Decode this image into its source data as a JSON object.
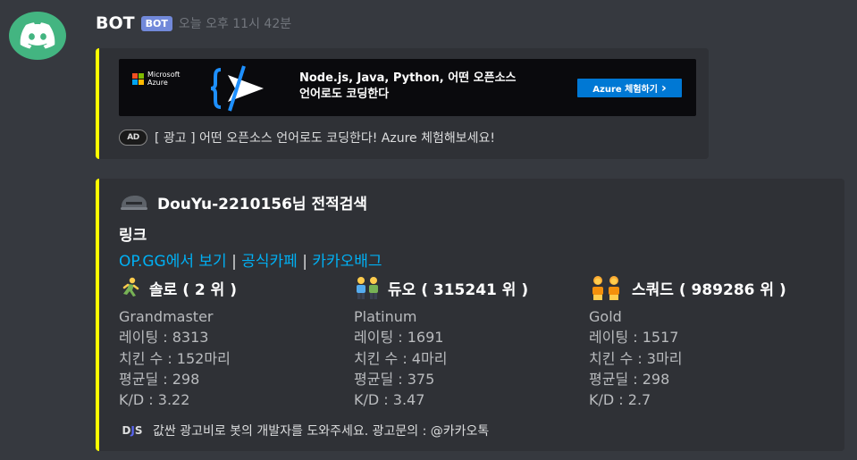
{
  "message": {
    "author": "BOT",
    "bot_tag": "BOT",
    "timestamp": "오늘 오후 11시 42분"
  },
  "ad_embed": {
    "banner": {
      "brand_line1": "Microsoft",
      "brand_line2": "Azure",
      "headline_line1": "Node.js, Java, Python, 어떤 오픈소스",
      "headline_line2": "언어로도 코딩한다",
      "cta_label": "Azure 체험하기",
      "cta_arrow": "›"
    },
    "footer_icon_text": "AD",
    "footer_text": "[ 광고 ] 어떤 오픈소스 언어로도 코딩한다! Azure 체험해보세요!"
  },
  "stats_embed": {
    "author_name": "DouYu-2210156님 전적검색",
    "field_title": "링크",
    "links": [
      "OP.GG에서 보기",
      "공식카페",
      "카카오배그"
    ],
    "link_separator": " | ",
    "columns": [
      {
        "icon": "solo-runner-emoji",
        "title": "솔로 ( 2 위 )",
        "tier": "Grandmaster",
        "rating": "레이팅 : 8313",
        "kills": "치킨 수 : 152마리",
        "avg_damage": "평균딜 : 298",
        "kd": "K/D : 3.22"
      },
      {
        "icon": "duo-people-emoji",
        "title": "듀오 ( 315241 위 )",
        "tier": "Platinum",
        "rating": "레이팅 : 1691",
        "kills": "치킨 수 : 4마리",
        "avg_damage": "평균딜 : 375",
        "kd": "K/D : 3.47"
      },
      {
        "icon": "squad-people-emoji",
        "title": "스쿼드 ( 989286 위 )",
        "tier": "Gold",
        "rating": "레이팅 : 1517",
        "kills": "치킨 수 : 3마리",
        "avg_damage": "평균딜 : 298",
        "kd": "K/D : 2.7"
      }
    ],
    "footer_icon_text_d": "D",
    "footer_icon_text_j": "J",
    "footer_icon_text_s": "S",
    "footer_text": "값싼 광고비로 봇의 개발자를 도와주세요. 광고문의 : @카카오톡"
  },
  "colors": {
    "background": "#36393f",
    "embed_bg": "#2f3136",
    "embed_accent": "#ffff00",
    "link": "#00b0f4",
    "bot_tag": "#7289da",
    "avatar": "#43b581"
  }
}
